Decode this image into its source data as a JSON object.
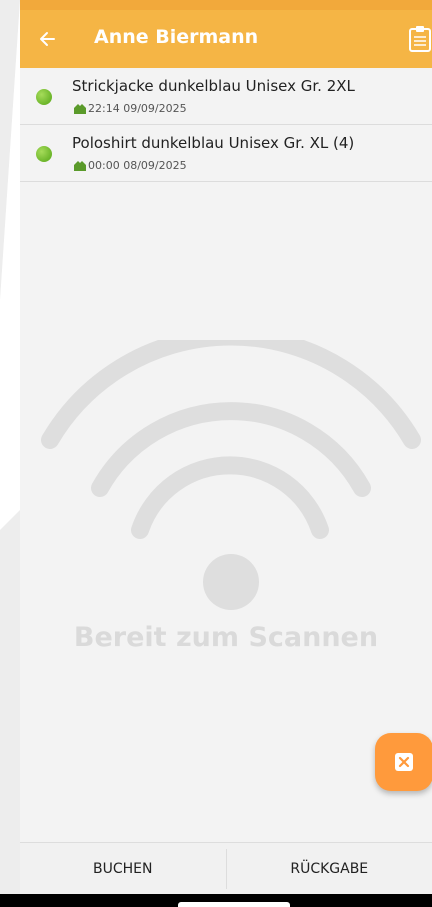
{
  "header": {
    "title": "Anne Biermann",
    "back_icon": "arrow-left-icon",
    "action_icon": "clipboard-icon"
  },
  "items": [
    {
      "title": "Strickjacke dunkelblau Unisex Gr. 2XL",
      "timestamp": "22:14 09/09/2025",
      "status_color": "#7ac142"
    },
    {
      "title": "Poloshirt dunkelblau Unisex Gr. XL (4)",
      "timestamp": "00:00 08/09/2025",
      "status_color": "#7ac142"
    }
  ],
  "scan": {
    "label": "Bereit zum Scannen",
    "icon": "wifi-scan-icon"
  },
  "fab": {
    "icon": "close-box-icon"
  },
  "bottom_bar": {
    "book_label": "BUCHEN",
    "return_label": "RÜCKGABE"
  },
  "colors": {
    "accent": "#f5b545",
    "fab": "#ff9a3c"
  }
}
